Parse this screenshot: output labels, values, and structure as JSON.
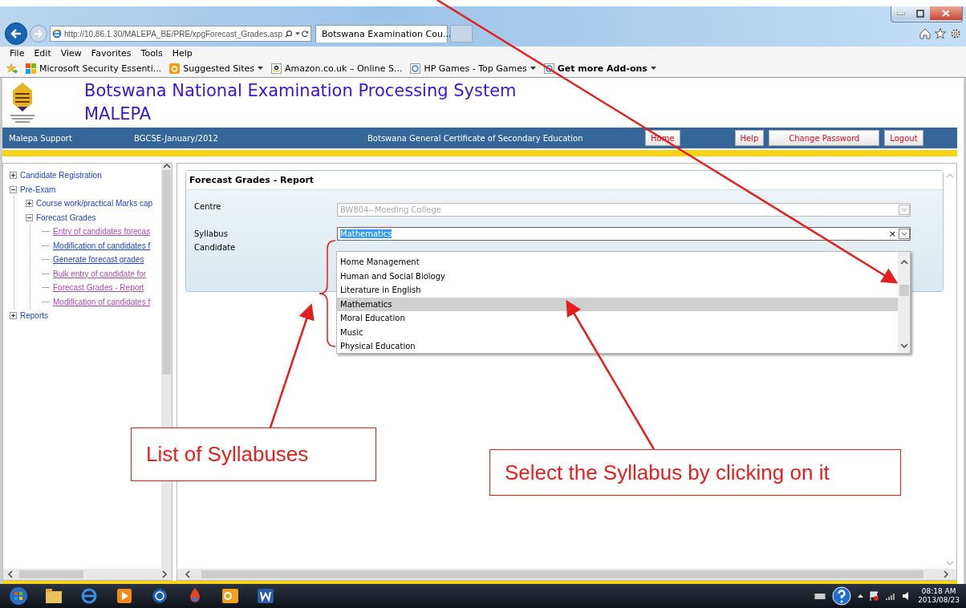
{
  "browser": {
    "address": "http://10.86.1.30/MALEPA_BE/PRE/xpgForecast_Grades.asp",
    "tab_title": "Botswana Examination Cou...",
    "menu": [
      "File",
      "Edit",
      "View",
      "Favorites",
      "Tools",
      "Help"
    ],
    "favorites": [
      {
        "label": "Microsoft Security Essenti...",
        "dropdown": false,
        "bold": false
      },
      {
        "label": "Suggested Sites",
        "dropdown": true,
        "bold": false
      },
      {
        "label": "Amazon.co.uk – Online S...",
        "dropdown": false,
        "bold": false
      },
      {
        "label": "HP Games - Top Games",
        "dropdown": true,
        "bold": false
      },
      {
        "label": "Get more Add-ons",
        "dropdown": true,
        "bold": true
      }
    ]
  },
  "header": {
    "title": "Botswana National Examination Processing System",
    "subtitle": "MALEPA"
  },
  "nav": {
    "support": "Malepa Support",
    "session": "BGCSE-January/2012",
    "qualification": "Botswana General Certificate of Secondary Education",
    "buttons": [
      {
        "label": "Home"
      },
      {
        "label": "Help"
      },
      {
        "label": "Change Password"
      },
      {
        "label": "Logout"
      }
    ]
  },
  "sidebar": {
    "tree": [
      {
        "label": "Candidate Registration",
        "expanded": false
      },
      {
        "label": "Pre-Exam",
        "expanded": true,
        "children": [
          {
            "label": "Course work/practical Marks cap",
            "expanded": false
          },
          {
            "label": "Forecast Grades",
            "expanded": true,
            "children": [
              {
                "label": "Entry of candidates forecas",
                "visited": true
              },
              {
                "label": "Modification of candidates f",
                "visited": false
              },
              {
                "label": "Generate forecast grades",
                "visited": false
              },
              {
                "label": "Bulk entry of candidate for",
                "visited": true
              },
              {
                "label": "Forecast Grades - Report",
                "visited": true
              },
              {
                "label": "Modification of candidates f",
                "visited": true
              }
            ]
          }
        ]
      },
      {
        "label": "Reports",
        "expanded": false
      }
    ]
  },
  "form": {
    "title": "Forecast Grades - Report",
    "centre": {
      "label": "Centre",
      "value": "BW804--Moeding College",
      "disabled": true
    },
    "syllabus": {
      "label": "Syllabus",
      "value": "Mathematics",
      "text_selected": true,
      "clear": "×"
    },
    "candidate": {
      "label": "Candidate"
    },
    "options": [
      {
        "label": "Home Management",
        "selected": false
      },
      {
        "label": "Human and Social Biology",
        "selected": false
      },
      {
        "label": "Literature in English",
        "selected": false
      },
      {
        "label": "Mathematics",
        "selected": true
      },
      {
        "label": "Moral Education",
        "selected": false
      },
      {
        "label": "Music",
        "selected": false
      },
      {
        "label": "Physical Education",
        "selected": false
      }
    ]
  },
  "callouts": [
    {
      "text": "List of Syllabuses"
    },
    {
      "text": "Select the Syllabus by clicking on it"
    }
  ],
  "taskbar": {
    "time": "08:18 AM",
    "date": "2013/08/23"
  }
}
